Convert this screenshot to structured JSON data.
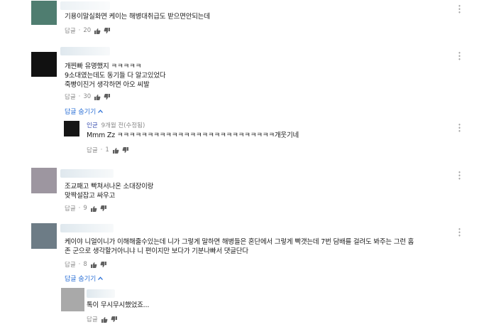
{
  "comments": [
    {
      "lines": [
        "기용이말실화면 케이는 해병대취급도 받으면안되는데"
      ],
      "reply_label": "답글",
      "likes": "20",
      "avatar_color": "#4f7d70"
    },
    {
      "lines": [
        "개찐빠 유명했지 ㅋㅋㅋㅋㅋ",
        "9소대였는데도 동기들 다 알고있었다",
        "죽빵이진거 생각하면 아오 씨발"
      ],
      "reply_label": "답글",
      "likes": "30",
      "hide_replies_label": "답글 숨기기",
      "avatar_color": "#111111",
      "replies": [
        {
          "author": "인균",
          "time": "9개월 전(수정됨)",
          "text": "Mmm Zz ㅋㅋㅋㅋㅋㅋㅋㅋㅋㅋㅋㅋㅋㅋㅋㅋㅋㅋㅋㅋㅋㅋㅋㅋㅋㅋ개웃기네",
          "reply_label": "답글",
          "likes": "1",
          "avatar_color": "#151515"
        }
      ]
    },
    {
      "lines": [
        "조교패고 빡쳐서나온 소대장이랑",
        "맞짝설잡고 싸우고"
      ],
      "reply_label": "답글",
      "likes": "9",
      "avatar_color": "#9d96a0"
    },
    {
      "lines": [
        "케이야 니얼이니가 이해해줄수있는데 니가 그렇게 말하면 해병들은 혼단에서 그렇게 빡갯는데 7번 담배를 걸려도 봐주는 그런 홈",
        "존 군으로 생각할거아니냐 니 편이지만 보다가 기분나빠서 댓글단다"
      ],
      "reply_label": "답글",
      "likes": "8",
      "hide_replies_label": "답글 숨기기",
      "avatar_color": "#6d7c86",
      "replies": [
        {
          "text": "톡이 무시무시했었죠...",
          "reply_label": "답글",
          "avatar_color": "#a9a9a9"
        }
      ]
    }
  ],
  "icons": [
    "thumbs-up-icon",
    "thumbs-down-icon",
    "more-vert-icon",
    "chevron-up-icon"
  ],
  "colors": {
    "link": "#2a6fd6",
    "meta": "#8a8a8a",
    "text": "#1a1a1a",
    "author": "#3a4fb0"
  }
}
